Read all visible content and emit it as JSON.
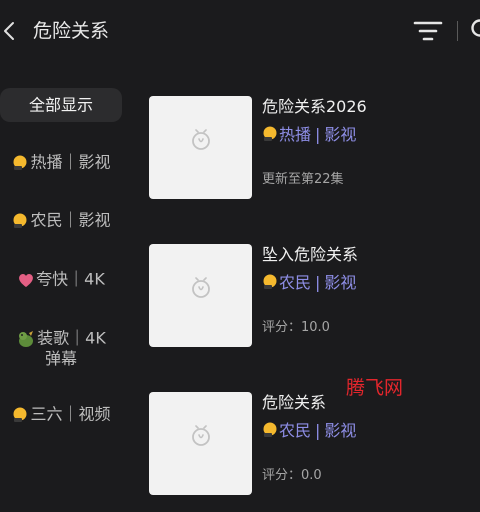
{
  "header": {
    "title": "危险关系"
  },
  "sidebar": {
    "items": [
      {
        "emoji": "",
        "label": "全部显示",
        "active": true
      },
      {
        "emoji": "🌢",
        "label": "热播｜影视"
      },
      {
        "emoji": "🌢",
        "label": "农民｜影视"
      },
      {
        "emoji": "❤",
        "label": "夸快｜4K"
      },
      {
        "emoji": "🐲",
        "label": "装歌｜4K",
        "label2": "弹幕"
      },
      {
        "emoji": "🌢",
        "label": "三六｜视频"
      }
    ]
  },
  "results": [
    {
      "title": "危险关系2026",
      "source": "热播",
      "category": "影视",
      "meta": "更新至第22集"
    },
    {
      "title": "坠入危险关系",
      "source": "农民",
      "category": "影视",
      "meta": "评分：10.0"
    },
    {
      "title": "危险关系",
      "source": "农民",
      "category": "影视",
      "meta": "评分：0.0"
    }
  ],
  "watermark": "腾飞网",
  "colors": {
    "background": "#1b1b1d",
    "tag": "#8e8ee6",
    "watermark": "#e3262c"
  }
}
